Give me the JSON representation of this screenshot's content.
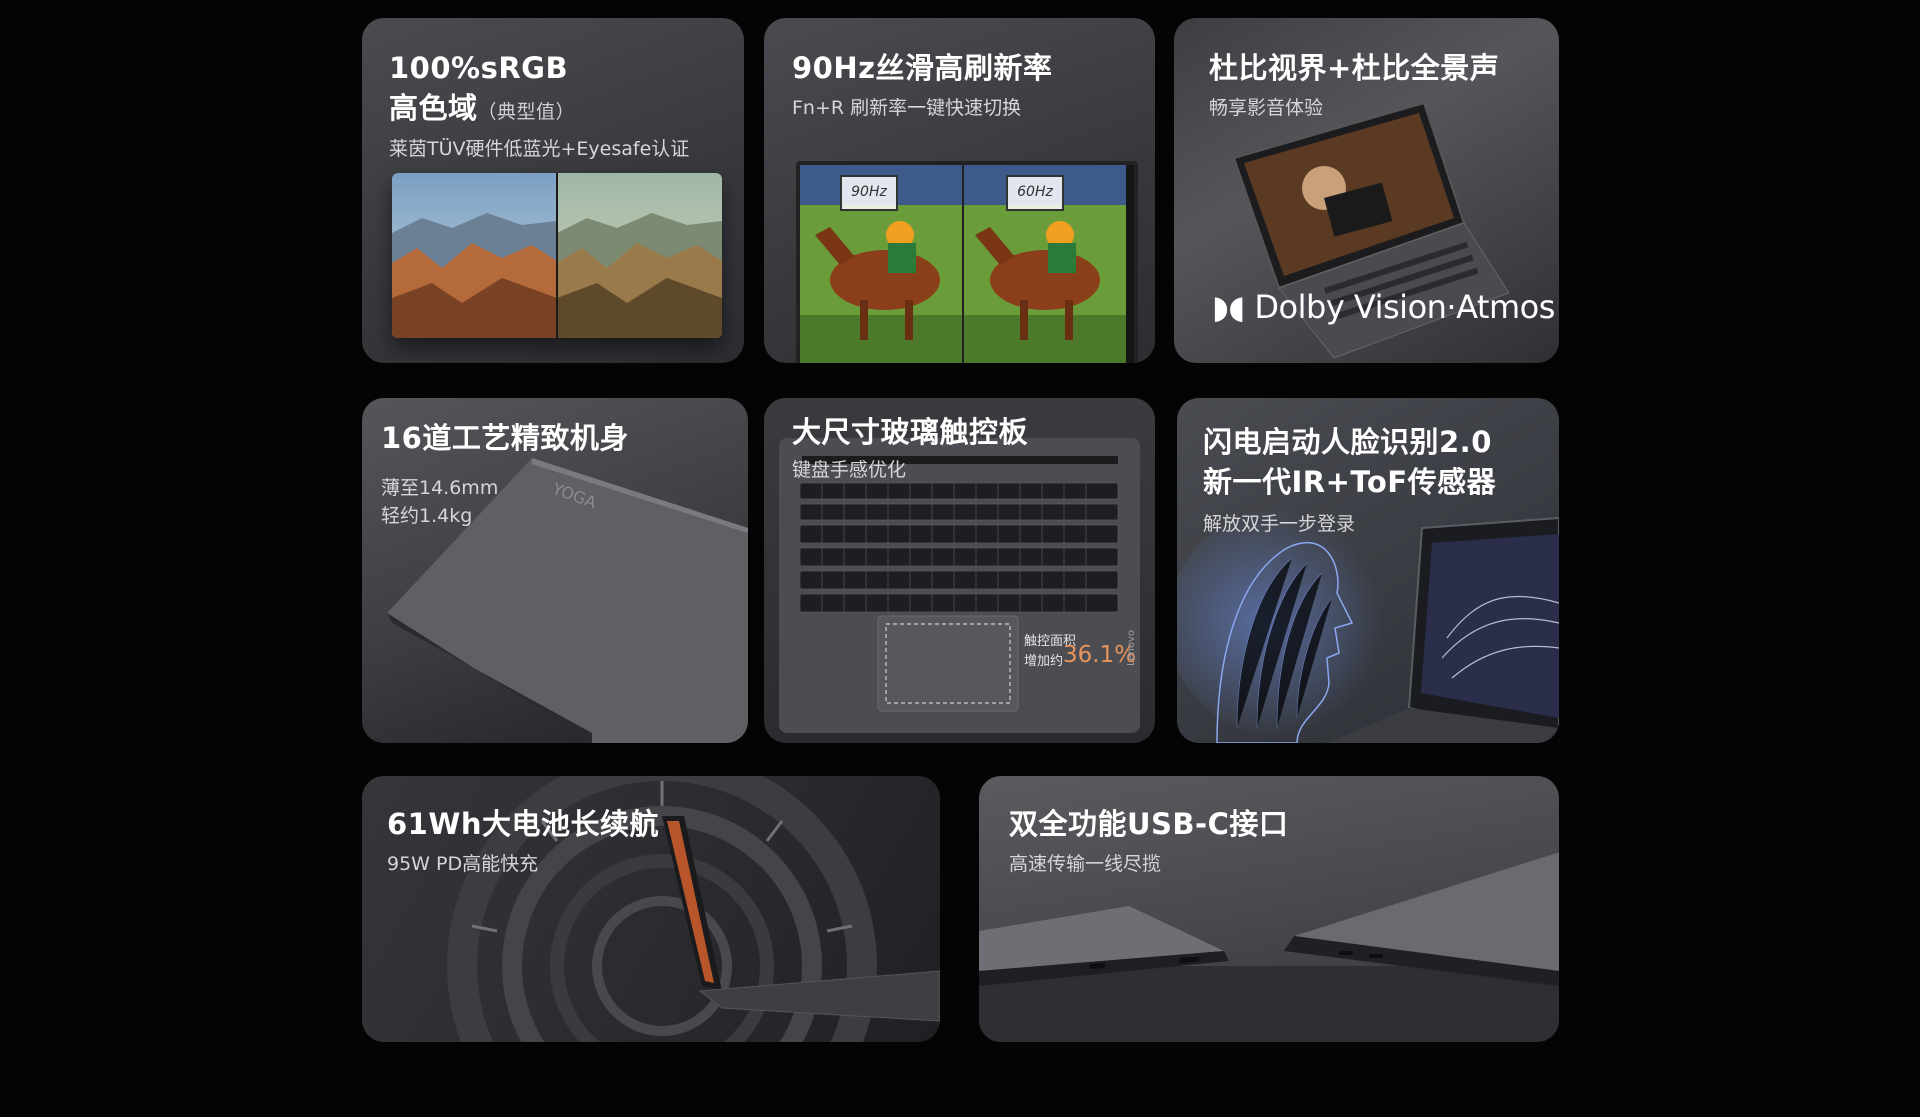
{
  "cards": [
    {
      "id": "color",
      "title_line1": "100%sRGB",
      "title_line2": "高色域",
      "title_note": "（典型值）",
      "subtitle": "莱茵TÜV硬件低蓝光+Eyesafe认证"
    },
    {
      "id": "refresh",
      "title": "90Hz丝滑高刷新率",
      "subtitle": "Fn+R 刷新率一键快速切换",
      "badge_left": "90Hz",
      "badge_right": "60Hz"
    },
    {
      "id": "dolby",
      "title": "杜比视界+杜比全景声",
      "subtitle": "畅享影音体验",
      "logo_text": "Dolby Vision·Atmos"
    },
    {
      "id": "craft",
      "title": "16道工艺精致机身",
      "subtitle_line1": "薄至14.6mm",
      "subtitle_line2": "轻约1.4kg",
      "brand": "YOGA"
    },
    {
      "id": "touchpad",
      "title": "大尺寸玻璃触控板",
      "subtitle": "键盘手感优化",
      "callout_line1": "触控面积",
      "callout_line2": "增加约",
      "callout_value": "36.1%",
      "brand": "Lenovo"
    },
    {
      "id": "faceid",
      "title_line1": "闪电启动人脸识别2.0",
      "title_line2": "新一代IR+ToF传感器",
      "subtitle": "解放双手一步登录"
    },
    {
      "id": "battery",
      "title": "61Wh大电池长续航",
      "subtitle": "95W PD高能快充"
    },
    {
      "id": "usbc",
      "title": "双全功能USB-C接口",
      "subtitle": "高速传输一线尽揽"
    }
  ],
  "colors": {
    "background": "#040404",
    "card": "#3e3f43",
    "accent_orange": "#e8935a"
  }
}
